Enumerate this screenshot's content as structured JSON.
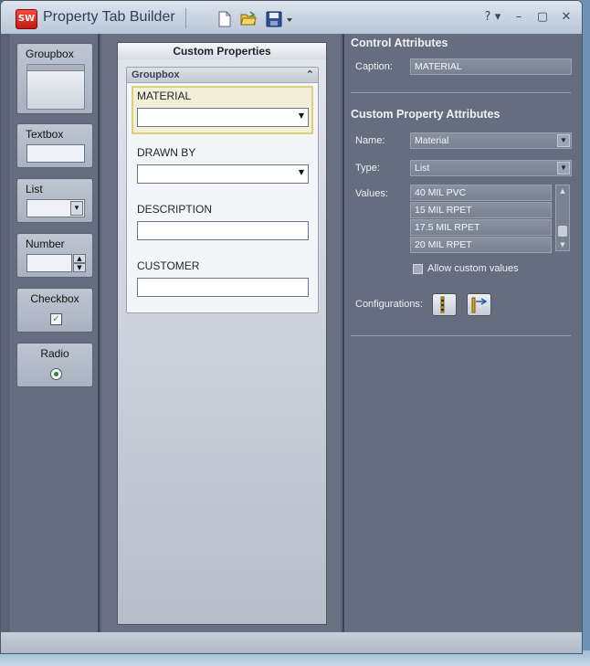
{
  "window": {
    "title": "Property Tab Builder",
    "logo_text": "SW",
    "controls": {
      "help": "?",
      "help_dd": "▾",
      "minimize": "–",
      "maximize": "▢",
      "close": "✕"
    }
  },
  "toolbar": {
    "icons": [
      "new-document-icon",
      "open-folder-icon",
      "save-icon",
      "save-dropdown-icon"
    ]
  },
  "toolbox": {
    "items": [
      {
        "label": "Groupbox"
      },
      {
        "label": "Textbox"
      },
      {
        "label": "List"
      },
      {
        "label": "Number"
      },
      {
        "label": "Checkbox"
      },
      {
        "label": "Radio"
      }
    ]
  },
  "form": {
    "header": "Custom Properties",
    "groupbox": {
      "title": "Groupbox",
      "collapse_glyph": "⌃",
      "fields": [
        {
          "label": "MATERIAL",
          "type": "combo",
          "value": ""
        },
        {
          "label": "DRAWN BY",
          "type": "combo",
          "value": ""
        },
        {
          "label": "DESCRIPTION",
          "type": "text",
          "value": ""
        },
        {
          "label": "CUSTOMER",
          "type": "text",
          "value": ""
        }
      ]
    }
  },
  "attributes": {
    "control_section": "Control Attributes",
    "caption_label": "Caption:",
    "caption_value": "MATERIAL",
    "custom_section": "Custom Property Attributes",
    "name_label": "Name:",
    "name_value": "Material",
    "type_label": "Type:",
    "type_value": "List",
    "values_label": "Values:",
    "values": [
      "40 MIL PVC",
      "15 MIL RPET",
      "17.5 MIL RPET",
      "20 MIL RPET"
    ],
    "allow_custom_label": "Allow custom values",
    "allow_custom_checked": false,
    "configurations_label": "Configurations:"
  }
}
